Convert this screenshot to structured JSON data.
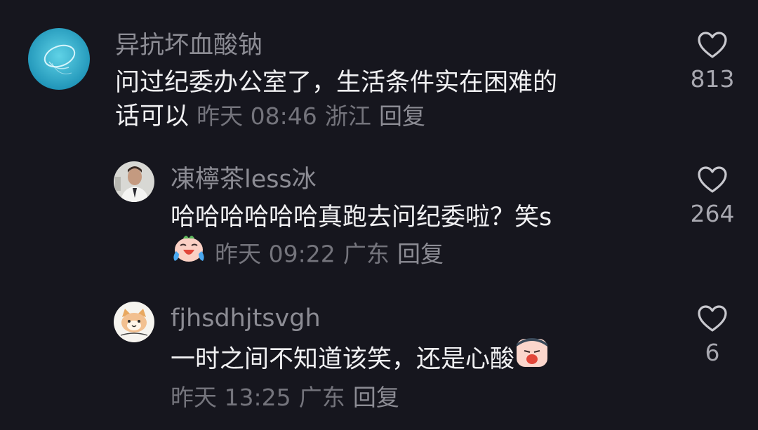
{
  "comments": [
    {
      "author": "异抗坏血酸钠",
      "text_line1": "问过纪委办公室了，生活条件实在困难的",
      "text_line2": "话可以",
      "time": "昨天 08:46",
      "location": "浙江",
      "reply_label": "回复",
      "likes": "813",
      "avatar_icon": "jellyfish-avatar-icon"
    },
    {
      "author": "凍檸茶less冰",
      "text_line1": "哈哈哈哈哈哈真跑去问纪委啦？笑s",
      "time": "昨天 09:22",
      "location": "广东",
      "reply_label": "回复",
      "likes": "264",
      "emoji": "laughing-crying-emoji-icon",
      "avatar_icon": "man-portrait-avatar-icon"
    },
    {
      "author": "fjhsdhjtsvgh",
      "text_line1": "一时之间不知道该笑，还是心酸",
      "time": "昨天 13:25",
      "location": "广东",
      "reply_label": "回复",
      "likes": "6",
      "emoji": "sad-face-emoji-icon",
      "avatar_icon": "cat-cartoon-avatar-icon"
    }
  ],
  "colors": {
    "background": "#16161e",
    "author": "#8c8c94",
    "text": "#f0f0f2",
    "meta": "#74747c"
  }
}
